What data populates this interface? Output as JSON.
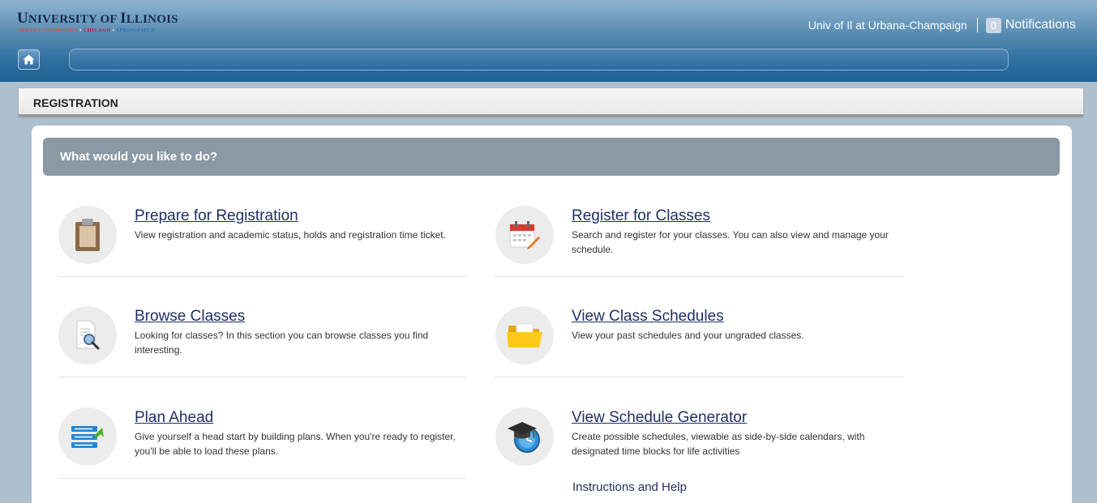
{
  "header": {
    "logo": {
      "main_first": "U",
      "main_rest": "NIVERSITY OF ",
      "main_second": "I",
      "main_rest2": "LLINOIS",
      "sub1": "URBANA-CHAMPAIGN",
      "sub2": "CHICAGO",
      "sub3": "SPRINGFIELD",
      "dot": " • "
    },
    "campus": "Univ of Il at Urbana-Champaign",
    "notifications_count": "0",
    "notifications_label": "Notifications"
  },
  "section": {
    "title": "REGISTRATION"
  },
  "banner": {
    "text": "What would you like to do?"
  },
  "items": [
    {
      "title": "Prepare for Registration",
      "desc": "View registration and academic status, holds and registration time ticket.",
      "icon": "clipboard-icon"
    },
    {
      "title": "Register for Classes",
      "desc": "Search and register for your classes. You can also view and manage your schedule.",
      "icon": "calendar-icon"
    },
    {
      "title": "Browse Classes",
      "desc": "Looking for classes? In this section you can browse classes you find interesting.",
      "icon": "magnifier-document-icon"
    },
    {
      "title": "View Class Schedules",
      "desc": "View your past schedules and your ungraded classes.",
      "icon": "folder-icon"
    },
    {
      "title": "Plan Ahead",
      "desc": "Give yourself a head start by building plans. When you're ready to register, you'll be able to load these plans.",
      "icon": "plan-list-icon"
    },
    {
      "title": "View Schedule Generator",
      "desc": "Create possible schedules, viewable as side-by-side calendars, with designated time blocks for life activities",
      "icon": "graduation-clock-icon"
    }
  ],
  "help": {
    "label": "Instructions and Help"
  },
  "colors": {
    "header_dark": "#1f5f92",
    "link": "#1f2f66",
    "banner": "#8a99a4"
  }
}
